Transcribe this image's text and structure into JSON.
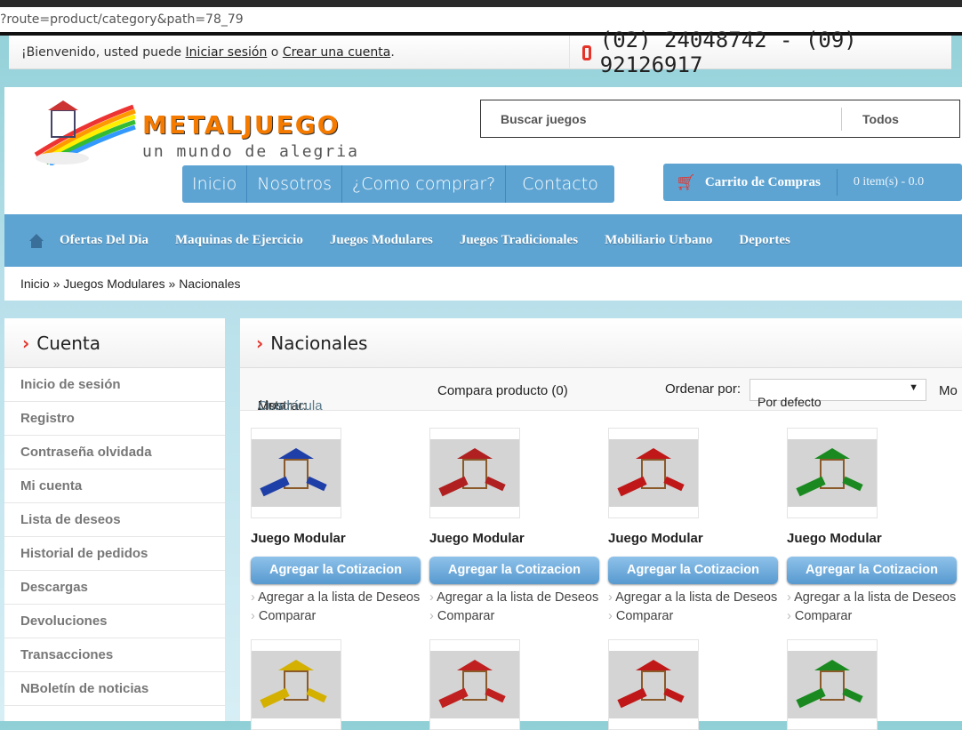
{
  "browser": {
    "url": "?route=product/category&path=78_79"
  },
  "topbar": {
    "welcome_prefix": "¡Bienvenido, usted puede ",
    "login": "Iniciar sesión",
    "or": " o ",
    "register": "Crear una cuenta",
    "period": ".",
    "phone": "(02) 24048742 - (09) 92126917"
  },
  "header": {
    "brand": "METALJUEGO",
    "tagline": "un mundo de alegria",
    "search_placeholder": "Buscar juegos",
    "category": "Todos",
    "menu": [
      "Inicio",
      "Nosotros",
      "¿Como comprar?",
      "Contacto"
    ],
    "cart": {
      "label": "Carrito de Compras",
      "value": "0 item(s) - 0.0"
    }
  },
  "nav": [
    "Ofertas Del Dia",
    "Maquinas de Ejercicio",
    "Juegos Modulares",
    "Juegos Tradicionales",
    "Mobiliario Urbano",
    "Deportes"
  ],
  "breadcrumb": "Inicio » Juegos Modulares » Nacionales",
  "sidebar": {
    "title": "Cuenta",
    "items": [
      "Inicio de sesión",
      "Registro",
      "Contraseña olvidada",
      "Mi cuenta",
      "Lista de deseos",
      "Historial de pedidos",
      "Descargas",
      "Devoluciones",
      "Transacciones",
      "NBoletín de noticias"
    ]
  },
  "main": {
    "title": "Nacionales",
    "show_label": "Mostrar:",
    "list": "Lista",
    "sep": " / ",
    "grid": "Cuadrícula",
    "compare": "Compara producto (0)",
    "sort_label": "Ordenar por:",
    "sort_value": "Por defecto",
    "more": "Mo",
    "products": [
      {
        "name": "Juego Modular",
        "button": "Agregar la Cotizacion",
        "wishlist": "Agregar a la lista de Deseos",
        "compare": "Comparar",
        "color": "#1f3fa8"
      },
      {
        "name": "Juego Modular",
        "button": "Agregar la Cotizacion",
        "wishlist": "Agregar a la lista de Deseos",
        "compare": "Comparar",
        "color": "#b02020"
      },
      {
        "name": "Juego Modular",
        "button": "Agregar la Cotizacion",
        "wishlist": "Agregar a la lista de Deseos",
        "compare": "Comparar",
        "color": "#c01818"
      },
      {
        "name": "Juego Modular",
        "button": "Agregar la Cotizacion",
        "wishlist": "Agregar a la lista de Deseos",
        "compare": "Comparar",
        "color": "#1a8a20"
      }
    ],
    "row2_colors": [
      "#d4b000",
      "#c02020",
      "#c01818",
      "#1a8a20"
    ]
  }
}
